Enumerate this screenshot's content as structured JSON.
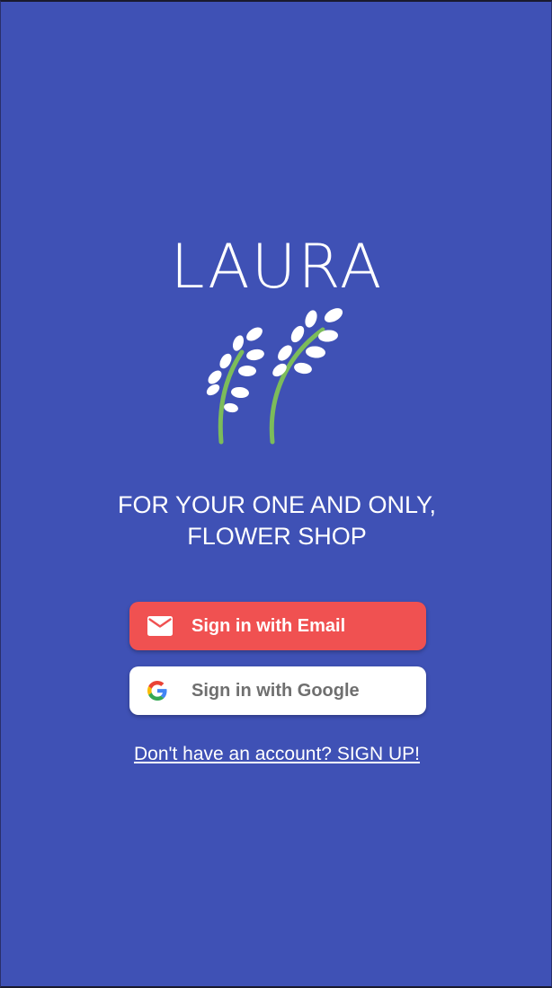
{
  "app": {
    "title": "LAURA",
    "tagline_line1": "FOR YOUR ONE AND ONLY,",
    "tagline_line2": "FLOWER SHOP"
  },
  "buttons": {
    "email_label": "Sign in with Email",
    "google_label": "Sign in with Google"
  },
  "signup": {
    "link_text": "Don't have an account? SIGN UP!"
  },
  "icons": {
    "logo": "lavender-sprigs-logo",
    "email": "mail-icon",
    "google": "google-g-icon"
  },
  "colors": {
    "background": "#3f51b5",
    "email_button": "#f05151",
    "google_button": "#ffffff",
    "stem": "#7cbc5a"
  }
}
